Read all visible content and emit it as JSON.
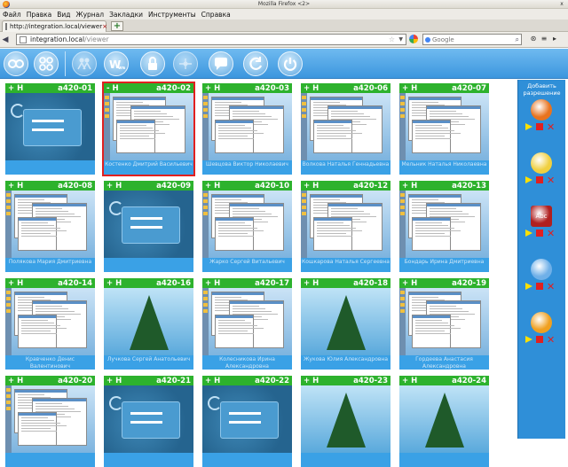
{
  "window": {
    "title": "Mozilla Firefox <2>",
    "close_glyph": "x"
  },
  "menu": [
    "Файл",
    "Правка",
    "Вид",
    "Журнал",
    "Закладки",
    "Инструменты",
    "Справка"
  ],
  "tab": {
    "label": "http://integration.local/viewer",
    "close_glyph": "×"
  },
  "newtab_glyph": "+",
  "address": {
    "host": "integration.local",
    "path": "/viewer"
  },
  "search": {
    "placeholder": "Google"
  },
  "toolbar": {
    "icons": [
      "view-large-icon",
      "view-grid-icon",
      "users-icon",
      "web-icon",
      "lock-icon",
      "dots-icon",
      "chat-icon",
      "refresh-icon",
      "power-icon"
    ]
  },
  "tiles": [
    {
      "host": "a420-01",
      "toggle": "+ H",
      "shot": "login",
      "name": ""
    },
    {
      "host": "a420-02",
      "toggle": "- H",
      "shot": "desk",
      "name": "Костенко Дмитрий Васильевич",
      "selected": true
    },
    {
      "host": "a420-03",
      "toggle": "+ H",
      "shot": "desk",
      "name": "Шевцова Виктор Николаевич"
    },
    {
      "host": "a420-06",
      "toggle": "+ H",
      "shot": "desk",
      "name": "Волкова Наталья Геннадьевна"
    },
    {
      "host": "a420-07",
      "toggle": "+ H",
      "shot": "desk",
      "name": "Мельник Наталья Николаевна"
    },
    {
      "host": "a420-08",
      "toggle": "+ H",
      "shot": "desk",
      "name": "Полякова Мария Дмитриевна"
    },
    {
      "host": "a420-09",
      "toggle": "+ H",
      "shot": "login",
      "name": ""
    },
    {
      "host": "a420-10",
      "toggle": "+ H",
      "shot": "desk",
      "name": "Жарко Сергей Витальевич"
    },
    {
      "host": "a420-12",
      "toggle": "+ H",
      "shot": "desk",
      "name": "Кошкарова Наталья Сергеевна"
    },
    {
      "host": "a420-13",
      "toggle": "+ H",
      "shot": "desk",
      "name": "Бондарь Ирина Дмитриевна"
    },
    {
      "host": "a420-14",
      "toggle": "+ H",
      "shot": "desk",
      "name": "Кравченко Денис Валентинович"
    },
    {
      "host": "a420-16",
      "toggle": "+ H",
      "shot": "tree",
      "name": "Лучкова Сергей Анатольевич"
    },
    {
      "host": "a420-17",
      "toggle": "+ H",
      "shot": "desk",
      "name": "Колесникова Ирина Александровна"
    },
    {
      "host": "a420-18",
      "toggle": "+ H",
      "shot": "tree",
      "name": "Жукова Юлия Александровна"
    },
    {
      "host": "a420-19",
      "toggle": "+ H",
      "shot": "desk",
      "name": "Гордеева Анастасия Александровна"
    },
    {
      "host": "a420-20",
      "toggle": "+ H",
      "shot": "desk",
      "name": ""
    },
    {
      "host": "a420-21",
      "toggle": "+ H",
      "shot": "login",
      "name": ""
    },
    {
      "host": "a420-22",
      "toggle": "+ H",
      "shot": "login",
      "name": ""
    },
    {
      "host": "a420-23",
      "toggle": "+ H",
      "shot": "tree",
      "name": ""
    },
    {
      "host": "a420-24",
      "toggle": "+ H",
      "shot": "tree",
      "name": ""
    }
  ],
  "sidebar": {
    "title": "Добавить разрешение",
    "items": [
      {
        "icon": "firefox-icon",
        "color": "#e8731f"
      },
      {
        "icon": "teapot-icon",
        "color": "#f0d040"
      },
      {
        "icon": "dictionary-icon",
        "color": "#b02020",
        "label": "Abc"
      },
      {
        "icon": "gear-snowflake-icon",
        "color": "#6fb0e8"
      },
      {
        "icon": "rss-reader-icon",
        "color": "#f0a020"
      }
    ]
  }
}
